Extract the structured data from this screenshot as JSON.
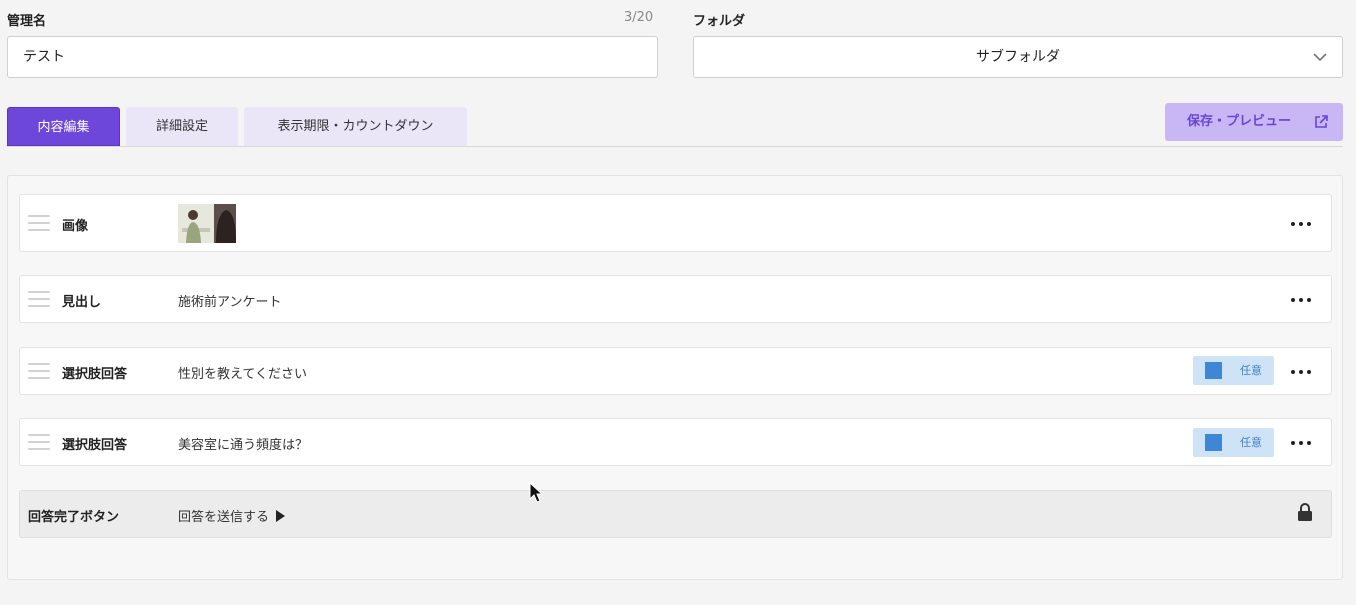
{
  "form": {
    "name_label": "管理名",
    "name_counter": "3/20",
    "name_value": "テスト",
    "folder_label": "フォルダ",
    "folder_value": "サブフォルダ"
  },
  "tabs": [
    {
      "label": "内容編集",
      "active": true
    },
    {
      "label": "詳細設定",
      "active": false
    },
    {
      "label": "表示期限・カウントダウン",
      "active": false
    }
  ],
  "preview_button": {
    "label": "保存・プレビュー",
    "icon": "external-link-icon"
  },
  "rows": [
    {
      "type": "画像",
      "value": "",
      "has_image": true,
      "badge": null
    },
    {
      "type": "見出し",
      "value": "施術前アンケート",
      "badge": null
    },
    {
      "type": "選択肢回答",
      "value": "性別を教えてください",
      "badge": "任意"
    },
    {
      "type": "選択肢回答",
      "value": "美容室に通う頻度は？",
      "badge": "任意"
    },
    {
      "type": "回答完了ボタン",
      "value": "回答を送信する",
      "locked": true
    }
  ],
  "colors": {
    "accent": "#6d47d9",
    "tab_inactive": "#eae6f8",
    "preview_bg": "#c9b6f4",
    "badge_bg": "#cfe3f7",
    "badge_square": "#3f86d4"
  }
}
